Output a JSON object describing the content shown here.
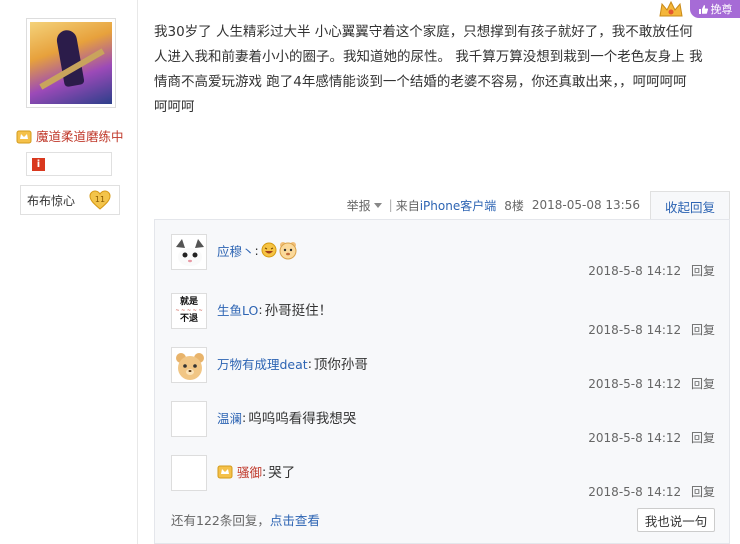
{
  "header": {
    "vip_label": "挽尊"
  },
  "author": {
    "name": "魔道柔道磨练中",
    "badge_name": "布布惊心",
    "badge_level": "11"
  },
  "post": {
    "text": "我30岁了 人生精彩过大半 小心翼翼守着这个家庭，只想撑到有孩子就好了，我不敢放任何\n人进入我和前妻着小小的圈子。我知道她的尿性。 我千算万算没想到栽到一个老色友身上 我\n情商不高爱玩游戏 跑了4年感情能谈到一个结婚的老婆不容易，你还真敢出来，，呵呵呵呵\n呵呵呵"
  },
  "meta": {
    "report_label": "举报",
    "source_prefix": "来自",
    "source_link": "iPhone客户端",
    "floor": "8楼",
    "datetime": "2018-05-08 13:56",
    "collapse_label": "收起回复"
  },
  "replies": [
    {
      "user": "应穆丶",
      "colon": ":",
      "text": "",
      "time": "2018-5-8 14:12",
      "reply_label": "回复"
    },
    {
      "user": "生鱼LO",
      "colon": ":",
      "text": "孙哥挺住！",
      "time": "2018-5-8 14:12",
      "reply_label": "回复"
    },
    {
      "user": "万物有成理deat",
      "colon": ":",
      "text": "顶你孙哥",
      "time": "2018-5-8 14:12",
      "reply_label": "回复"
    },
    {
      "user": "温澜",
      "colon": ":",
      "text": "呜呜呜看得我想哭",
      "time": "2018-5-8 14:12",
      "reply_label": "回复"
    },
    {
      "user": "骚御",
      "colon": ":",
      "text": "哭了",
      "time": "2018-5-8 14:12",
      "reply_label": "回复"
    }
  ],
  "reply_avatar_text": {
    "line1": "就是",
    "line2": "不退"
  },
  "footer": {
    "more_prefix": "还有122条回复，",
    "more_link": "点击查看",
    "say_button": "我也说一句"
  },
  "colors": {
    "link": "#2d64b3",
    "author_name": "#c0392b",
    "vip": "#a66bd6",
    "panel_bg": "#f7f8fa"
  }
}
